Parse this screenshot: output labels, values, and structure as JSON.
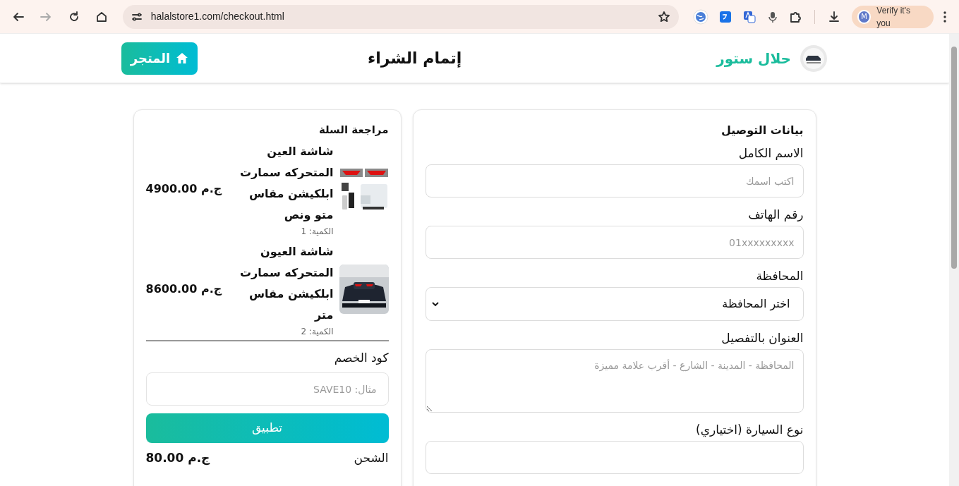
{
  "browser": {
    "url": "halalstore1.com/checkout.html",
    "profile_initial": "M",
    "profile_label": "Verify it's you"
  },
  "header": {
    "brand": "حلال ستور",
    "title": "إتمام الشراء",
    "store_button": "المتجر"
  },
  "delivery": {
    "title": "بيانات التوصيل",
    "fields": [
      {
        "kind": "input",
        "label": "الاسم الكامل",
        "placeholder": "اكتب اسمك"
      },
      {
        "kind": "input",
        "label": "رقم الهاتف",
        "placeholder": "01xxxxxxxxx"
      },
      {
        "kind": "select",
        "label": "المحافظة",
        "value": "اختر المحافظة"
      },
      {
        "kind": "textarea",
        "label": "العنوان بالتفصيل",
        "placeholder": "المحافظة - المدينة - الشارع - أقرب علامة مميزة"
      },
      {
        "kind": "input",
        "label": "نوع السيارة (اختياري)"
      }
    ]
  },
  "cart": {
    "title": "مراجعة السلة",
    "items": [
      {
        "kind": "eyes",
        "name": "شاشة العين المتحركه سمارت ابلكيشن مقاس متو ونص",
        "quantity": "الكمية: 1",
        "price": "4900.00 ج.م"
      },
      {
        "kind": "car",
        "name": "شاشة العيون المتحركه سمارت ابلكيشن مقاس متر",
        "quantity": "الكمية: 2",
        "price": "8600.00 ج.م"
      }
    ],
    "discount": {
      "label": "كود الخصم",
      "placeholder": "مثال: SAVE10",
      "button": "تطبيق"
    },
    "summary": [
      {
        "label": "الشحن",
        "value": "80.00 ج.م"
      }
    ]
  }
}
